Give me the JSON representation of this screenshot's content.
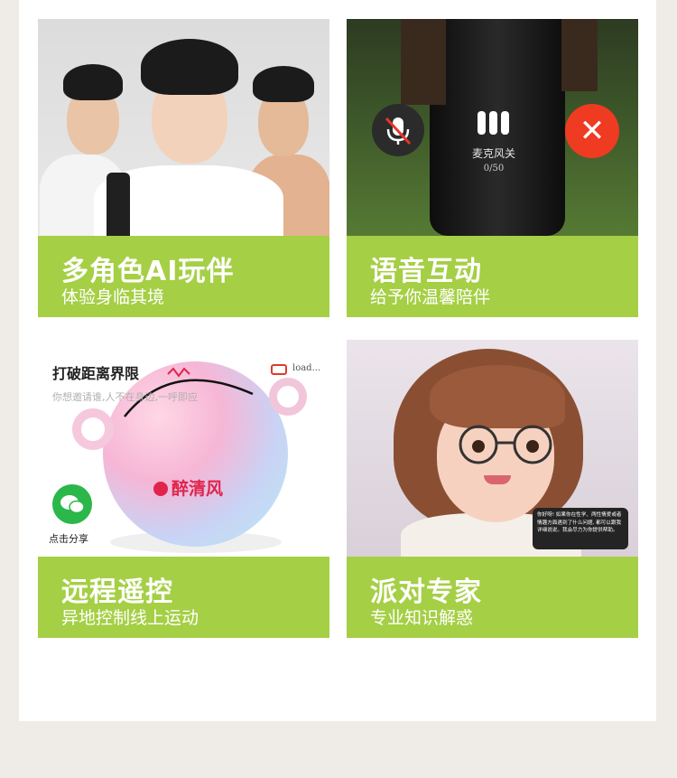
{
  "cards": [
    {
      "title": "多角色AI玩伴",
      "subtitle": "体验身临其境"
    },
    {
      "title": "语音互动",
      "subtitle": "给予你温馨陪伴",
      "mic_label": "麦克风关",
      "counter": "0/50"
    },
    {
      "title": "远程遥控",
      "subtitle": "异地控制线上运动",
      "img_title": "打破距离界限",
      "img_desc": "你想邀请谁,人不在身边,一呼即应",
      "brand": "醉清风",
      "load_text": "load...",
      "share_label": "点击分享"
    },
    {
      "title": "派对专家",
      "subtitle": "专业知识解惑",
      "bubble_text": "你好呀! 如果你在性学、两性情爱或者情趣方面遇到了什么问题, 都可以跟我详细说说。我会尽力为你提供帮助。"
    }
  ],
  "colors": {
    "band": "#a5cf45",
    "close": "#ee3b22",
    "wechat": "#2bb749",
    "brand": "#e0244c"
  }
}
